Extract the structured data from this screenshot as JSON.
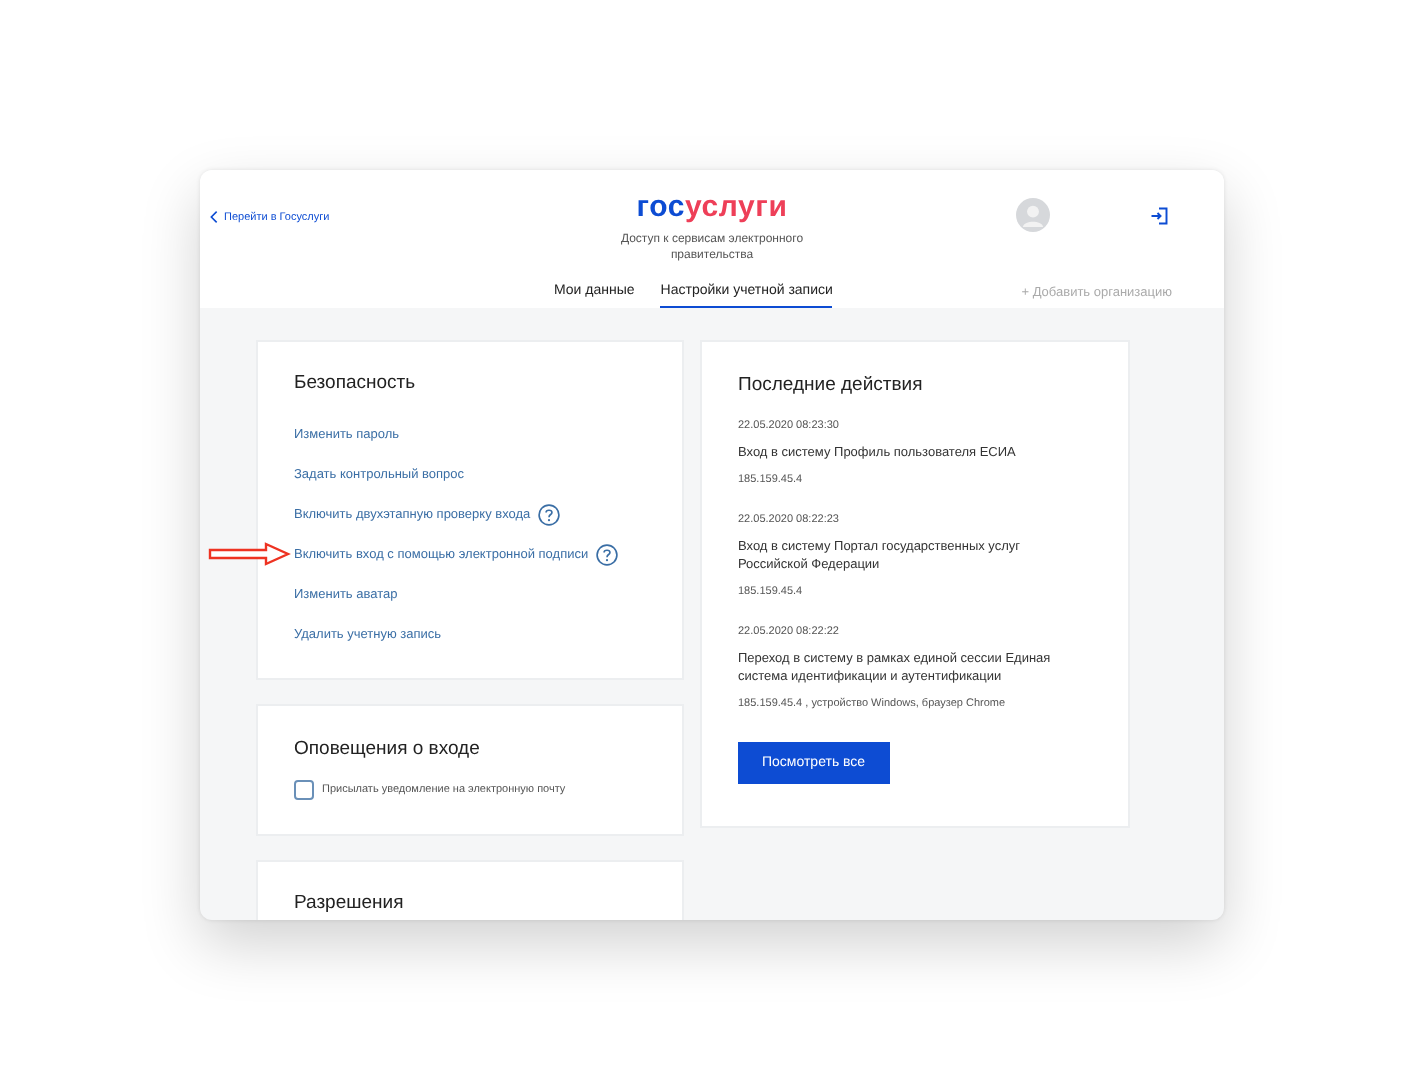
{
  "header": {
    "back_link": "Перейти в Госуслуги",
    "logo": [
      {
        "text": "гос",
        "color": "#0d4cd3"
      },
      {
        "text": "услуги",
        "color": "#ee3f58"
      }
    ],
    "subtitle": "Доступ к сервисам электронного правительства",
    "tabs": [
      {
        "label": "Мои данные",
        "selected": false
      },
      {
        "label": "Настройки учетной записи",
        "selected": true
      }
    ],
    "add_organization": "+ Добавить организацию"
  },
  "security": {
    "title": "Безопасность",
    "items": [
      {
        "label": "Изменить пароль",
        "help": false,
        "annotated": false
      },
      {
        "label": "Задать контрольный вопрос",
        "help": false,
        "annotated": false
      },
      {
        "label": "Включить двухэтапную проверку входа",
        "help": true,
        "annotated": false
      },
      {
        "label": "Включить вход с помощью электронной подписи",
        "help": true,
        "annotated": true
      },
      {
        "label": "Изменить аватар",
        "help": false,
        "annotated": false
      },
      {
        "label": "Удалить учетную запись",
        "help": false,
        "annotated": false
      }
    ]
  },
  "notifications": {
    "title": "Оповещения о входе",
    "options": [
      {
        "label": "Присылать уведомление на электронную почту",
        "checked": false
      }
    ]
  },
  "permissions": {
    "title": "Разрешения"
  },
  "recent": {
    "title": "Последние действия",
    "events": [
      {
        "time": "22.05.2020 08:23:30",
        "action": "Вход в систему Профиль пользователя ЕСИА",
        "details": "185.159.45.4"
      },
      {
        "time": "22.05.2020 08:22:23",
        "action": "Вход в систему Портал государственных услуг Российской Федерации",
        "details": "185.159.45.4"
      },
      {
        "time": "22.05.2020 08:22:22",
        "action": "Переход в систему в рамках единой сессии Единая система идентификации и аутентификации",
        "details": "185.159.45.4 , устройство Windows, браузер Chrome"
      }
    ],
    "button": "Посмотреть все"
  }
}
